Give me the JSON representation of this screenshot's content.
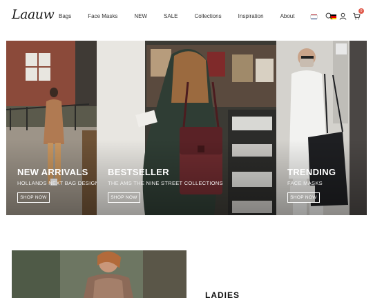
{
  "header": {
    "logo": "Laauw",
    "nav": [
      "Bags",
      "Face Masks",
      "NEW",
      "SALE",
      "Collections",
      "Inspiration",
      "About"
    ],
    "flags": [
      {
        "name": "netherlands-flag",
        "colors": [
          "#ae1c28",
          "#ffffff",
          "#21468b"
        ]
      },
      {
        "name": "germany-flag",
        "colors": [
          "#000000",
          "#dd0000",
          "#ffce00"
        ]
      }
    ],
    "icons": [
      "search-icon",
      "user-icon",
      "cart-icon"
    ],
    "cart_count": "0"
  },
  "banner": {
    "panels": [
      {
        "title": "NEW ARRIVALS",
        "subtitle": "HOLLANDS NEXT BAG DESIGNER",
        "button": "SHOP NOW"
      },
      {
        "title": "BESTSELLER",
        "subtitle": "THE AMS THE NINE STREET COLLECTIONS",
        "button": "SHOP NOW"
      },
      {
        "title": "TRENDING",
        "subtitle": "FACE MASKS",
        "button": "SHOP NOW"
      }
    ]
  },
  "categories": {
    "ladies_title": "LADIES"
  },
  "colors": {
    "accent": "#e0594a",
    "text": "#222222"
  }
}
